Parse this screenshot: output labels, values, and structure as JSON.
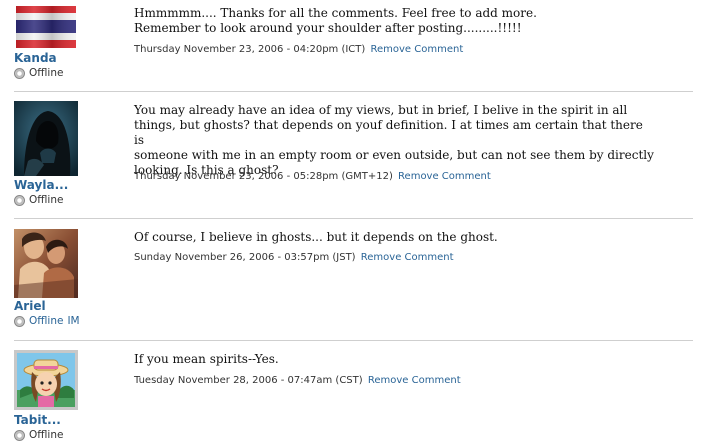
{
  "comments": [
    {
      "username": "Kanda",
      "status": "Offline",
      "text_lines": [
        "Hmmmmm.... Thanks for all the comments. Feel free to add more.",
        "Remember to look around your shoulder after posting.........!!!!!"
      ],
      "timestamp": "Thursday November 23, 2006 - 04:20pm (ICT)",
      "remove_label": "Remove Comment",
      "avatar_icon": "thai-flag-icon"
    },
    {
      "username": "Wayla...",
      "status": "Offline",
      "text_lines": [
        "You may already have an idea of my views, but in brief, I belive in the spirit in all",
        "things, but ghosts? that depends on youf definition. I at times am certain that there is",
        "someone with me in an empty room or even outside, but can not see them by directly",
        "looking. Is this a ghost?"
      ],
      "timestamp": "Thursday November 23, 2006 - 05:28pm (GMT+12)",
      "remove_label": "Remove Comment",
      "avatar_icon": "hooded-figure-icon"
    },
    {
      "username": "Ariel",
      "status": "Offline",
      "status_extra": "IM",
      "text_lines": [
        "Of course, I believe in ghosts... but it depends on the ghost."
      ],
      "timestamp": "Sunday November 26, 2006 - 03:57pm (JST)",
      "remove_label": "Remove Comment",
      "avatar_icon": "painting-avatar-icon"
    },
    {
      "username": "Tabit...",
      "status": "Offline",
      "text_lines": [
        "If you mean spirits--Yes."
      ],
      "timestamp": "Tuesday November 28, 2006 - 07:47am (CST)",
      "remove_label": "Remove Comment",
      "avatar_icon": "cartoon-girl-icon"
    }
  ],
  "colors": {
    "link": "#2a6496",
    "separator": "#cfcfcf"
  }
}
